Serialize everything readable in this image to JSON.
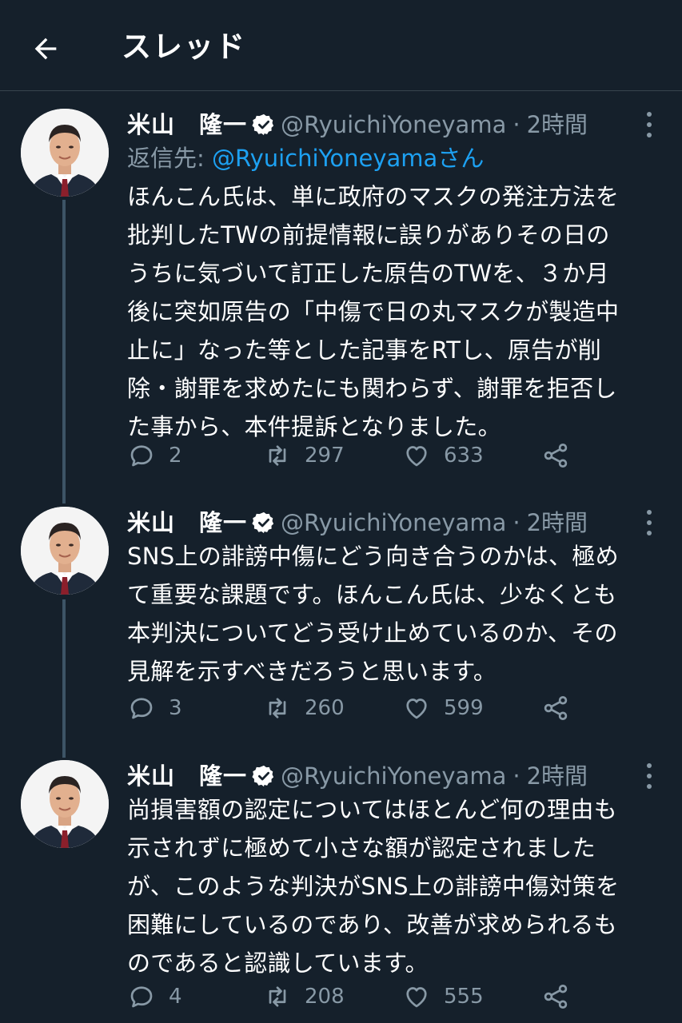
{
  "header": {
    "title": "スレッド",
    "back_icon": "arrow-left-icon"
  },
  "colors": {
    "background": "#15202b",
    "accent": "#1da1f2",
    "muted": "#8899a6",
    "divider": "#38444d"
  },
  "tweets": [
    {
      "display_name": "米山　隆一",
      "handle": "@RyuichiYoneyama",
      "dot": "·",
      "time": "2時間",
      "reply_prefix": "返信先: ",
      "reply_handle": "@RyuichiYoneyamaさん",
      "text": "ほんこん氏は、単に政府のマスクの発注方法を\n批判したTWの前提情報に誤りがありその日の\nうちに気づいて訂正した原告のTWを、３か月\n後に突如原告の「中傷で日の丸マスクが製造中\n止に」なった等とした記事をRTし、原告が削\n除・謝罪を求めたにも関わらず、謝罪を拒否し\nた事から、本件提訴となりました。",
      "replies": "2",
      "retweets": "297",
      "likes": "633"
    },
    {
      "display_name": "米山　隆一",
      "handle": "@RyuichiYoneyama",
      "dot": "·",
      "time": "2時間",
      "text": "SNS上の誹謗中傷にどう向き合うのかは、極め\nて重要な課題です。ほんこん氏は、少なくとも\n本判決についてどう受け止めているのか、その\n見解を示すべきだろうと思います。",
      "replies": "3",
      "retweets": "260",
      "likes": "599"
    },
    {
      "display_name": "米山　隆一",
      "handle": "@RyuichiYoneyama",
      "dot": "·",
      "time": "2時間",
      "text": "尚損害額の認定についてはほとんど何の理由も\n示されずに極めて小さな額が認定されました\nが、このような判決がSNS上の誹謗中傷対策を\n困難にしているのであり、改善が求められるも\nのであると認識しています。",
      "replies": "4",
      "retweets": "208",
      "likes": "555"
    }
  ]
}
